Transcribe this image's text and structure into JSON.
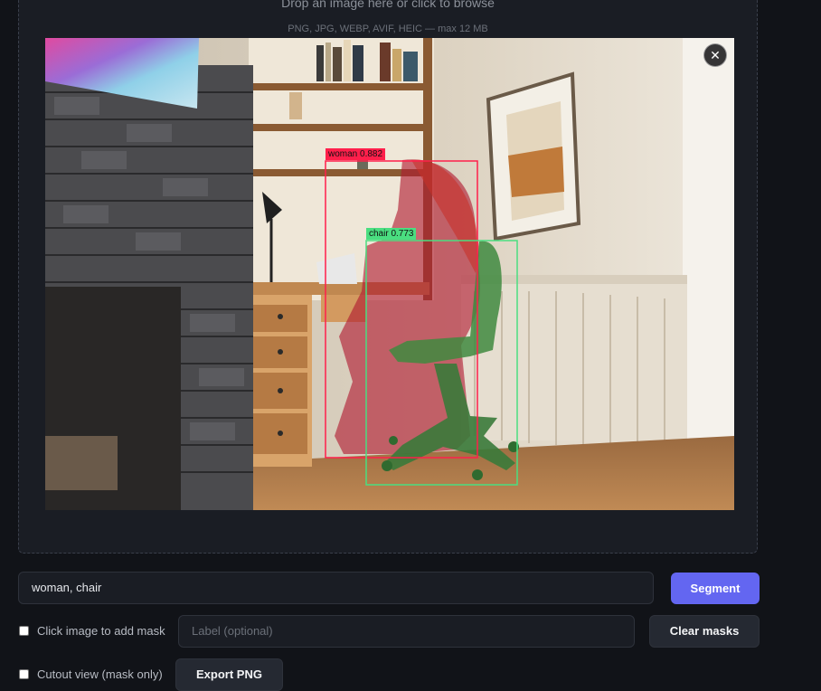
{
  "dropzone": {
    "title": "Drop an image here or click to browse",
    "subtitle": "PNG, JPG, WEBP, AVIF, HEIC — max 12 MB"
  },
  "preview": {
    "close_label": "✕",
    "detections": [
      {
        "label": "woman 0.882",
        "color": "#ff1f4b"
      },
      {
        "label": "chair 0.773",
        "color": "#4ade80"
      }
    ]
  },
  "controls": {
    "prompt_value": "woman, chair",
    "segment_label": "Segment",
    "click_mask_label": "Click image to add mask",
    "label_placeholder": "Label (optional)",
    "clear_masks_label": "Clear masks",
    "cutout_label": "Cutout view (mask only)",
    "export_label": "Export PNG"
  },
  "colors": {
    "accent": "#6366f1",
    "woman_mask": "#ff1f4b",
    "chair_mask": "#4ade80"
  }
}
